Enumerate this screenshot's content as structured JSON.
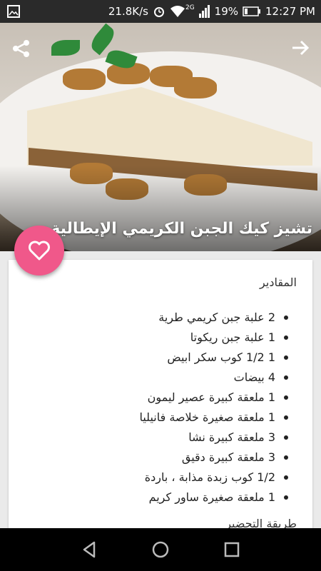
{
  "status_bar": {
    "speed": "21.8K/s",
    "network": "2G",
    "battery": "19%",
    "time": "12:27 PM",
    "icons": [
      "gallery-icon",
      "alarm-icon",
      "wifi-icon",
      "signal-icon",
      "battery-icon"
    ]
  },
  "hero": {
    "title": "تشيز كيك الجبن الكريمي الإيطالية",
    "subtitle": "-"
  },
  "colors": {
    "accent": "#f0588a",
    "status_bar": "#2a2a2a",
    "nav_bar": "#000000"
  },
  "ingredients": {
    "label": "المقادير",
    "items": [
      "2 علبة جبن كريمي طرية",
      "1 علبة جبن ريكوتا",
      "1 1/2 كوب سكر ابيض",
      "4 بيضات",
      "1 ملعقة كبيرة عصير ليمون",
      "1 ملعقة صغيرة خلاصة فانيليا",
      "3 ملعقة كبيرة نشا",
      "3 ملعقة كبيرة دقيق",
      "1/2 كوب زبدة مذابة ، باردة",
      "1 ملعقة صغيرة ساور كريم"
    ]
  },
  "preparation": {
    "label": "طريقة التحضير"
  }
}
